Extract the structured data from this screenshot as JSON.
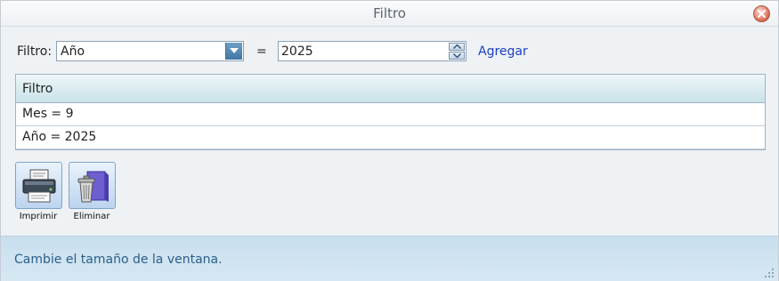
{
  "window": {
    "title": "Filtro"
  },
  "filter": {
    "label": "Filtro:",
    "field_value": "Año",
    "operator": "=",
    "value": "2025",
    "add_label": "Agregar"
  },
  "grid": {
    "header": "Filtro",
    "rows": [
      "Mes = 9",
      "Año = 2025"
    ]
  },
  "toolbar": {
    "print_label": "Imprimir",
    "delete_label": "Eliminar"
  },
  "status": {
    "text": "Cambie el tamaño de la ventana."
  },
  "colors": {
    "link": "#1a3fc4",
    "status_text": "#2b5f8a",
    "status_bg": "#d0e3f0"
  }
}
